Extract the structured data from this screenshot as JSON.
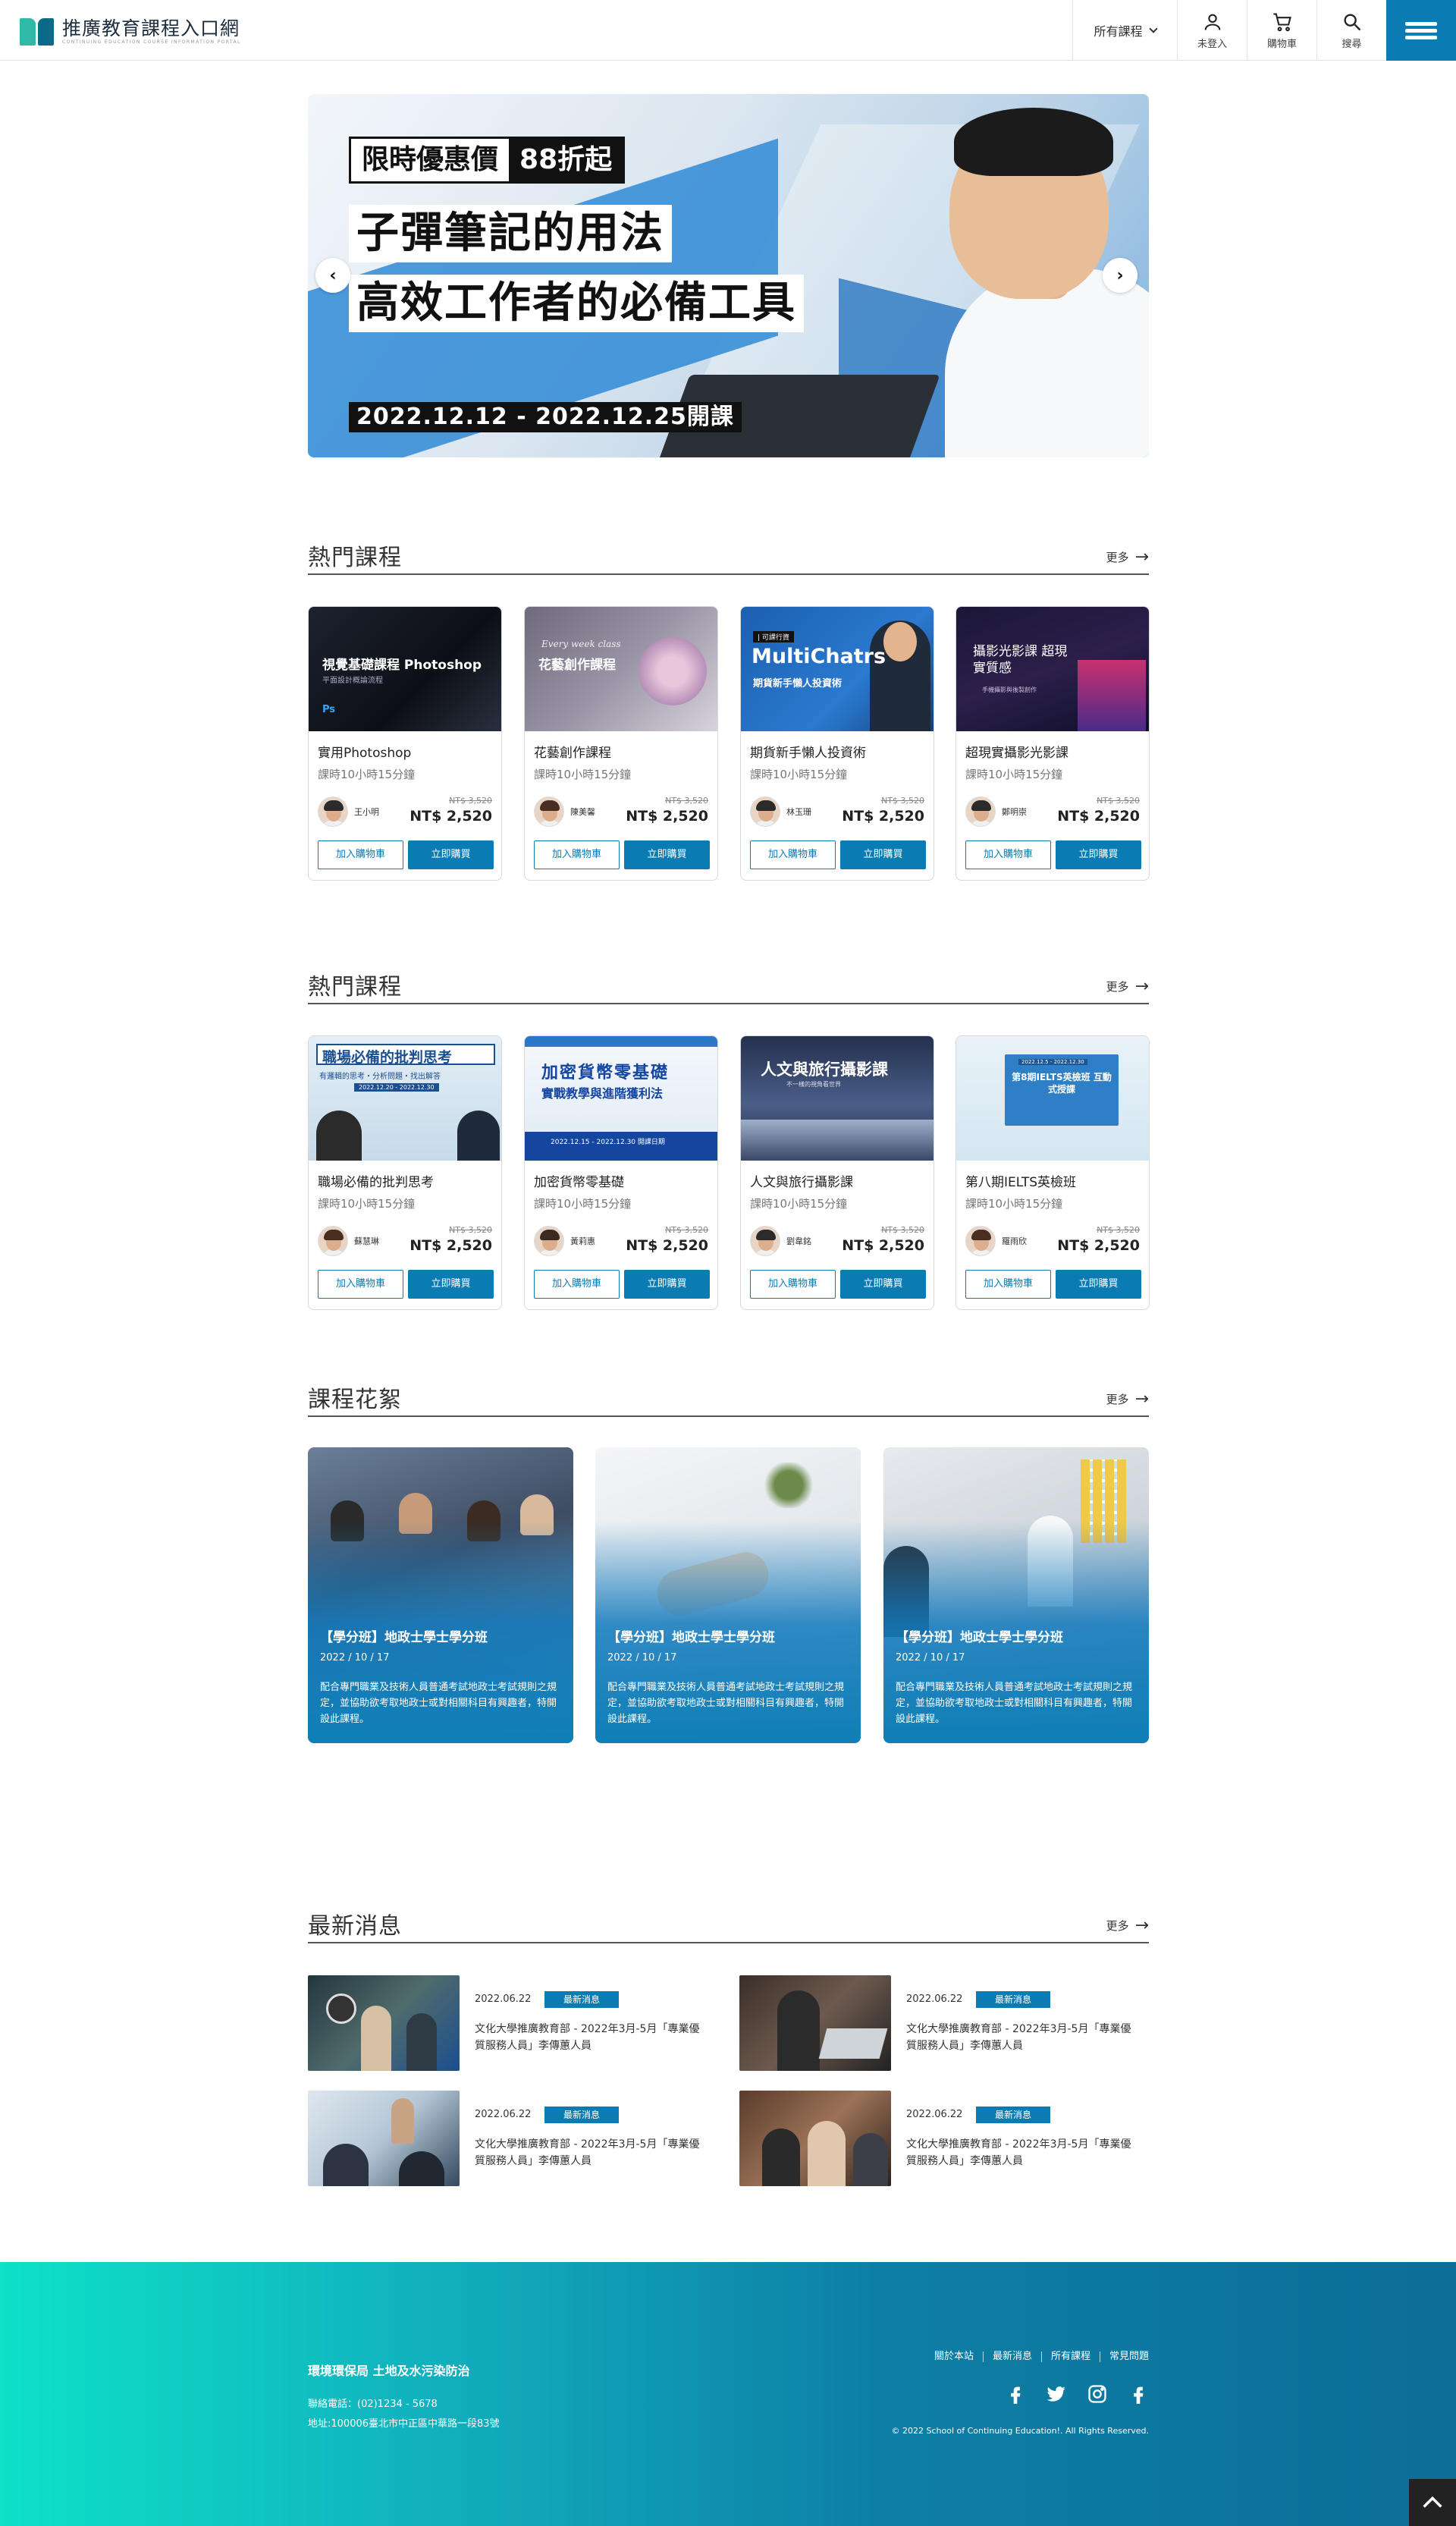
{
  "header": {
    "site_title": "推廣教育課程入口網",
    "site_subtitle": "CONTINUING EDUCATION COURSE INFORMATION PORTAL",
    "course_select": "所有課程",
    "login_label": "未登入",
    "cart_label": "購物車",
    "search_label": "搜尋",
    "icons": [
      "user-icon",
      "cart-icon",
      "search-icon",
      "menu-icon"
    ]
  },
  "hero": {
    "badge_left": "限時優惠價",
    "badge_right": "88折起",
    "line1": "子彈筆記的用法",
    "line2": "高效工作者的必備工具",
    "date": "2022.12.12 - 2022.12.25開課",
    "prev_icon": "‹",
    "next_icon": "›"
  },
  "popular1": {
    "title": "熱門課程",
    "more": "更多",
    "cards": [
      {
        "img_title": "視覺基礎課程 Photoshop",
        "img_sub": "平面設計概論流程",
        "img_tag": "Ps",
        "name": "實用Photoshop",
        "duration": "課時10小時15分鐘",
        "teacher": "王小明",
        "old_price": "NT$ 3,520",
        "price": "NT$ 2,520",
        "cart": "加入購物車",
        "buy": "立即購買"
      },
      {
        "img_title": "花藝創作課程",
        "img_sub": "Every week class",
        "img_tag": "",
        "name": "花藝創作課程",
        "duration": "課時10小時15分鐘",
        "teacher": "陳美馨",
        "old_price": "NT$ 3,520",
        "price": "NT$ 2,520",
        "cart": "加入購物車",
        "buy": "立即購買"
      },
      {
        "img_title": "MultiChatrs",
        "img_sub": "期貨新手懶人投資術",
        "img_tag": "| 可課行資",
        "name": "期貨新手懶人投資術",
        "duration": "課時10小時15分鐘",
        "teacher": "林玉珊",
        "old_price": "NT$ 3,520",
        "price": "NT$ 2,520",
        "cart": "加入購物車",
        "buy": "立即購買"
      },
      {
        "img_title": "攝影光影課 超現實質感",
        "img_sub": "手機攝影與後製創作",
        "img_tag": "",
        "name": "超現實攝影光影課",
        "duration": "課時10小時15分鐘",
        "teacher": "鄭明崇",
        "old_price": "NT$ 3,520",
        "price": "NT$ 2,520",
        "cart": "加入購物車",
        "buy": "立即購買"
      }
    ]
  },
  "popular2": {
    "title": "熱門課程",
    "more": "更多",
    "cards": [
      {
        "img_title": "職場必備的批判思考",
        "img_sub": "有邏輯的思考・分析問題・找出解答",
        "img_tag": "2022.12.20 - 2022.12.30",
        "name": "職場必備的批判思考",
        "duration": "課時10小時15分鐘",
        "teacher": "蘇慧琳",
        "old_price": "NT$ 3,520",
        "price": "NT$ 2,520",
        "cart": "加入購物車",
        "buy": "立即購買"
      },
      {
        "img_title": "加密貨幣零基礎",
        "img_sub": "實戰教學與進階獲利法",
        "img_tag": "2022.12.15 - 2022.12.30 開課日期",
        "name": "加密貨幣零基礎",
        "duration": "課時10小時15分鐘",
        "teacher": "黃莉惠",
        "old_price": "NT$ 3,520",
        "price": "NT$ 2,520",
        "cart": "加入購物車",
        "buy": "立即購買"
      },
      {
        "img_title": "人文與旅行攝影課",
        "img_sub": "不一樣的視角看世界",
        "img_tag": "",
        "name": "人文與旅行攝影課",
        "duration": "課時10小時15分鐘",
        "teacher": "劉韋銘",
        "old_price": "NT$ 3,520",
        "price": "NT$ 2,520",
        "cart": "加入購物車",
        "buy": "立即購買"
      },
      {
        "img_title": "第8期IELTS英檢班 互動式授課",
        "img_sub": "2022.12.5 - 2022.12.30",
        "img_tag": "",
        "name": "第八期IELTS英檢班",
        "duration": "課時10小時15分鐘",
        "teacher": "羅雨欣",
        "old_price": "NT$ 3,520",
        "price": "NT$ 2,520",
        "cart": "加入購物車",
        "buy": "立即購買"
      }
    ]
  },
  "gallery": {
    "title": "課程花絮",
    "more": "更多",
    "items": [
      {
        "title": "【學分班】地政士學士學分班",
        "date": "2022 / 10 / 17",
        "desc": "配合專門職業及技術人員普通考試地政士考試規則之規定，並協助欲考取地政士或對相關科目有興趣者，特開設此課程。"
      },
      {
        "title": "【學分班】地政士學士學分班",
        "date": "2022 / 10 / 17",
        "desc": "配合專門職業及技術人員普通考試地政士考試規則之規定，並協助欲考取地政士或對相關科目有興趣者，特開設此課程。"
      },
      {
        "title": "【學分班】地政士學士學分班",
        "date": "2022 / 10 / 17",
        "desc": "配合專門職業及技術人員普通考試地政士考試規則之規定，並協助欲考取地政士或對相關科目有興趣者，特開設此課程。"
      }
    ]
  },
  "news": {
    "title": "最新消息",
    "more": "更多",
    "items": [
      {
        "date": "2022.06.22",
        "badge": "最新消息",
        "text": "文化大學推廣教育部 - 2022年3月-5月「專業優質服務人員」李傳蕙人員"
      },
      {
        "date": "2022.06.22",
        "badge": "最新消息",
        "text": "文化大學推廣教育部 - 2022年3月-5月「專業優質服務人員」李傳蕙人員"
      },
      {
        "date": "2022.06.22",
        "badge": "最新消息",
        "text": "文化大學推廣教育部 - 2022年3月-5月「專業優質服務人員」李傳蕙人員"
      },
      {
        "date": "2022.06.22",
        "badge": "最新消息",
        "text": "文化大學推廣教育部 - 2022年3月-5月「專業優質服務人員」李傳蕙人員"
      }
    ]
  },
  "footer": {
    "org": "環境環保局 土地及水污染防治",
    "phone": "聯絡電話：(02)1234 - 5678",
    "address": "地址:100006臺北市中正區中華路一段83號",
    "links": [
      "關於本站",
      "最新消息",
      "所有課程",
      "常見問題"
    ],
    "social": [
      "facebook-icon",
      "twitter-icon",
      "instagram-icon",
      "facebook-icon"
    ],
    "copyright": "© 2022 School of Continuing Education!. All Rights Reserved."
  },
  "colors": {
    "brand": "#0a7cb3",
    "footer_start": "#0ee1c8",
    "footer_end": "#0c6e97"
  }
}
